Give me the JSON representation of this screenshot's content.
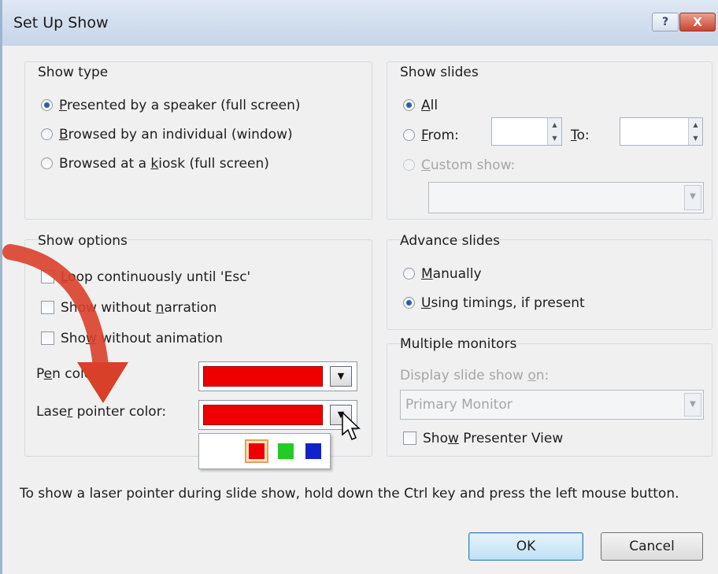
{
  "window": {
    "title": "Set Up Show",
    "help_label": "?",
    "close_label": "X"
  },
  "show_type": {
    "title": "Show type",
    "options": [
      {
        "pre": "",
        "key": "P",
        "post": "resented by a speaker (full screen)",
        "selected": true
      },
      {
        "pre": "",
        "key": "B",
        "post": "rowsed by an individual (window)",
        "selected": false
      },
      {
        "pre": "Browsed at a ",
        "key": "k",
        "post": "iosk (full screen)",
        "selected": false
      }
    ]
  },
  "show_slides": {
    "title": "Show slides",
    "all": {
      "pre": "",
      "key": "A",
      "post": "ll",
      "selected": true
    },
    "from": {
      "pre": "",
      "key": "F",
      "post": "rom:",
      "selected": false,
      "value": ""
    },
    "to": {
      "pre": "",
      "key": "T",
      "post": "o:",
      "value": ""
    },
    "custom": {
      "pre": "",
      "key": "C",
      "post": "ustom show:",
      "selected": false,
      "value": ""
    }
  },
  "show_options": {
    "title": "Show options",
    "checkboxes": [
      {
        "pre": "",
        "key": "L",
        "post": "oop continuously until 'Esc'",
        "checked": false
      },
      {
        "pre": "Show without ",
        "key": "n",
        "post": "arration",
        "checked": false
      },
      {
        "pre": "Sho",
        "key": "w",
        "post": " without animation",
        "checked": false
      }
    ],
    "pen_color": {
      "pre": "P",
      "key": "e",
      "post": "n color:",
      "value": "#ee0000"
    },
    "laser_color": {
      "pre": "Lase",
      "key": "r",
      "post": " pointer color:",
      "value": "#ee0000"
    },
    "palette": [
      "#ee0000",
      "#22cc22",
      "#1122cc"
    ],
    "dropdown_symbol": "▼"
  },
  "advance_slides": {
    "title": "Advance slides",
    "options": [
      {
        "pre": "",
        "key": "M",
        "post": "anually",
        "selected": false
      },
      {
        "pre": "",
        "key": "U",
        "post": "sing timings, if present",
        "selected": true
      }
    ]
  },
  "multiple_monitors": {
    "title": "Multiple monitors",
    "display_label": {
      "pre": "Display slide show ",
      "key": "o",
      "post": "n:"
    },
    "display_value": "Primary Monitor",
    "presenter_view": {
      "pre": "Sho",
      "key": "w",
      "post": " Presenter View",
      "checked": false
    }
  },
  "hint_text": "To show a laser pointer during slide show, hold down the Ctrl key and press the left mouse button.",
  "buttons": {
    "ok": "OK",
    "cancel": "Cancel"
  },
  "colors": {
    "accent_arrow": "#d9402a",
    "selection": "#2d5fa8"
  },
  "icons": {
    "arrow": "red-curved-arrow-icon",
    "cursor": "mouse-pointer-icon"
  }
}
